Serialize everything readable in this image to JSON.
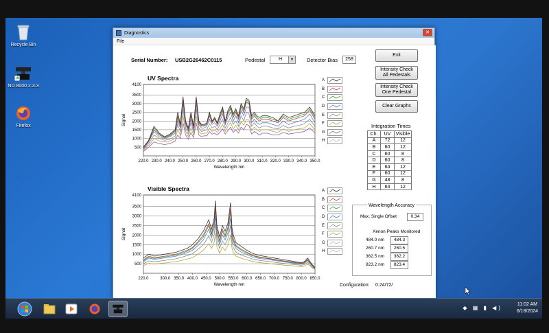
{
  "desktop": {
    "icons": [
      {
        "label": "Recycle Bin"
      },
      {
        "label": "ND 8000 2.3.3"
      },
      {
        "label": "Firefox"
      }
    ]
  },
  "window": {
    "title": "Diagnostics",
    "menu": [
      "File"
    ],
    "serial_label": "Serial Number:",
    "serial_value": "USB2G26462C0115",
    "pedestal_label": "Pedestal",
    "pedestal_value": "H",
    "detector_bias_label": "Detector Bias",
    "detector_bias_value": "258",
    "buttons": {
      "exit": "Exit",
      "intensity_all_1": "Intensity Check",
      "intensity_all_2": "All Pedestals",
      "intensity_one_1": "Intensity Check",
      "intensity_one_2": "One Pedestal",
      "clear": "Clear Graphs"
    },
    "integration": {
      "title": "Integration Times",
      "headers": [
        "Ch.",
        "UV",
        "Visible"
      ],
      "rows": [
        [
          "A",
          "72",
          "12"
        ],
        [
          "B",
          "60",
          "12"
        ],
        [
          "C",
          "60",
          "8"
        ],
        [
          "D",
          "60",
          "8"
        ],
        [
          "E",
          "64",
          "12"
        ],
        [
          "F",
          "60",
          "12"
        ],
        [
          "G",
          "48",
          "8"
        ],
        [
          "H",
          "64",
          "12"
        ]
      ]
    },
    "wavelength_accuracy": {
      "title": "Wavelength Accuracy",
      "max_offset_label": "Max. Single Offset",
      "max_offset_value": "0.34",
      "xenon_title": "Xenon Peaks Monitored",
      "peaks": [
        [
          "484.0 nm",
          "484.3"
        ],
        [
          "260.7 nm",
          "260.5"
        ],
        [
          "362.5 nm",
          "362.2"
        ],
        [
          "823.2 nm",
          "823.4"
        ]
      ]
    },
    "configuration_label": "Configuration:",
    "configuration_value": "0.24/72/"
  },
  "taskbar": {
    "time": "11:02 AM",
    "date": "6/18/2024"
  },
  "colors": {
    "accent": "#2c76cf",
    "series": [
      "#333333",
      "#c04040",
      "#3a9b3a",
      "#4a7ed0",
      "#888888",
      "#b5a640",
      "#9b59b6",
      "#c8c8c8"
    ]
  },
  "chart_data": [
    {
      "type": "line",
      "title": "UV Spectra",
      "xlabel": "Wavelength nm",
      "ylabel": "Signal",
      "xlim": [
        220,
        350
      ],
      "ylim": [
        0,
        4100
      ],
      "xticks": [
        220,
        230,
        240,
        250,
        260,
        270,
        280,
        290,
        300,
        310,
        320,
        330,
        340,
        350
      ],
      "xtick_labels": [
        "220.0",
        "230.0",
        "240.0",
        "250.0",
        "260.0",
        "270.0",
        "280.0",
        "290.0",
        "300.0",
        "310.0",
        "320.0",
        "330.0",
        "340.0",
        "350.0"
      ],
      "yticks": [
        500,
        1000,
        1500,
        2000,
        2500,
        3000,
        3500,
        4100
      ],
      "legend": [
        "A",
        "B",
        "C",
        "D",
        "E",
        "F",
        "G",
        "H"
      ],
      "grid": true,
      "x": [
        220,
        224,
        228,
        232,
        236,
        240,
        244,
        246,
        248,
        250,
        252,
        254,
        256,
        258,
        260,
        262,
        264,
        266,
        268,
        270,
        272,
        274,
        276,
        278,
        280,
        282,
        284,
        286,
        288,
        290,
        292,
        294,
        296,
        298,
        300,
        302,
        304,
        306,
        308,
        310,
        314,
        318,
        322,
        326,
        330,
        334,
        338,
        342,
        346,
        350
      ],
      "series": [
        {
          "values": [
            500,
            900,
            1700,
            1300,
            1100,
            1250,
            1500,
            2500,
            1800,
            3400,
            2000,
            1600,
            2500,
            1700,
            3400,
            2000,
            1800,
            1800,
            1900,
            2500,
            2000,
            2200,
            1900,
            2400,
            2800,
            2000,
            2600,
            2900,
            2400,
            2700,
            2300,
            3000,
            2700,
            3300,
            3200,
            2300,
            2500,
            2300,
            2200,
            2300,
            2300,
            2200,
            2000,
            2400,
            2200,
            2300,
            2400,
            2500,
            2800,
            2300
          ]
        },
        {
          "values": [
            450,
            850,
            1500,
            1200,
            1050,
            1150,
            1400,
            2200,
            1700,
            3200,
            1900,
            1500,
            2300,
            1600,
            3200,
            1900,
            1700,
            1700,
            1800,
            2300,
            1900,
            2100,
            1800,
            2200,
            2600,
            1900,
            2400,
            2700,
            2200,
            2500,
            2100,
            2800,
            2500,
            3100,
            3000,
            2100,
            2300,
            2100,
            2000,
            2100,
            2100,
            2000,
            1900,
            2200,
            2000,
            2100,
            2200,
            2300,
            2600,
            2100
          ]
        },
        {
          "values": [
            480,
            880,
            1600,
            1250,
            1080,
            1200,
            1450,
            2300,
            1750,
            3300,
            1950,
            1550,
            2400,
            1650,
            3300,
            1950,
            1750,
            1750,
            1850,
            2400,
            1950,
            2150,
            1850,
            2300,
            2700,
            1950,
            2500,
            2800,
            2300,
            2600,
            2200,
            2900,
            2600,
            3200,
            3100,
            2200,
            2400,
            2200,
            2100,
            2200,
            2200,
            2100,
            2000,
            2300,
            2100,
            2200,
            2300,
            2400,
            2700,
            2200
          ]
        },
        {
          "values": [
            400,
            800,
            1400,
            1100,
            1000,
            1100,
            1300,
            2000,
            1600,
            3000,
            1800,
            1400,
            2100,
            1500,
            3000,
            1800,
            1600,
            1600,
            1700,
            2100,
            1800,
            1900,
            1700,
            2000,
            2400,
            1800,
            2200,
            2500,
            2000,
            2300,
            1900,
            2600,
            2300,
            2800,
            2800,
            1900,
            2100,
            1900,
            1800,
            1900,
            1900,
            1800,
            1700,
            2000,
            1800,
            1900,
            2000,
            2100,
            2400,
            1900
          ]
        },
        {
          "values": [
            350,
            700,
            1200,
            1000,
            900,
            950,
            1150,
            1800,
            1400,
            2700,
            1600,
            1250,
            1900,
            1350,
            2700,
            1600,
            1400,
            1450,
            1500,
            1850,
            1600,
            1700,
            1500,
            1800,
            2100,
            1600,
            1900,
            2200,
            1800,
            2000,
            1700,
            2300,
            2000,
            2500,
            2400,
            1700,
            1900,
            1700,
            1600,
            1700,
            1700,
            1600,
            1550,
            1750,
            1600,
            1700,
            1750,
            1850,
            2100,
            1700
          ]
        },
        {
          "values": [
            300,
            600,
            1000,
            850,
            800,
            850,
            1000,
            1500,
            1200,
            2300,
            1400,
            1100,
            1600,
            1200,
            2300,
            1400,
            1250,
            1300,
            1300,
            1600,
            1400,
            1500,
            1350,
            1550,
            1800,
            1400,
            1700,
            1900,
            1550,
            1750,
            1500,
            1950,
            1750,
            2100,
            2050,
            1450,
            1650,
            1500,
            1400,
            1500,
            1500,
            1400,
            1350,
            1550,
            1400,
            1500,
            1550,
            1600,
            1850,
            1500
          ]
        },
        {
          "values": [
            250,
            500,
            800,
            700,
            650,
            700,
            850,
            1200,
            1000,
            1900,
            1200,
            950,
            1350,
            1050,
            1900,
            1200,
            1100,
            1150,
            1150,
            1400,
            1250,
            1300,
            1200,
            1350,
            1550,
            1250,
            1450,
            1650,
            1350,
            1500,
            1300,
            1650,
            1500,
            1800,
            1750,
            1250,
            1400,
            1300,
            1200,
            1300,
            1300,
            1200,
            1200,
            1350,
            1250,
            1300,
            1350,
            1400,
            1600,
            1300
          ]
        }
      ]
    },
    {
      "type": "line",
      "title": "Visible Spectra",
      "xlabel": "Wavelength nm",
      "ylabel": "Signal",
      "xlim": [
        220,
        850
      ],
      "ylim": [
        0,
        4100
      ],
      "xticks": [
        220,
        300,
        350,
        400,
        450,
        500,
        550,
        600,
        650,
        700,
        750,
        800,
        850
      ],
      "xtick_labels": [
        "220.0",
        "300.0",
        "350.0",
        "400.0",
        "450.0",
        "500.0",
        "550.0",
        "600.0",
        "650.0",
        "700.0",
        "750.0",
        "800.0",
        "850.0"
      ],
      "yticks": [
        500,
        1000,
        1500,
        2000,
        2500,
        3000,
        3500,
        4100
      ],
      "legend": [
        "A",
        "B",
        "C",
        "D",
        "E",
        "F",
        "G",
        "H"
      ],
      "grid": true,
      "x": [
        220,
        240,
        260,
        280,
        300,
        320,
        340,
        360,
        380,
        400,
        420,
        440,
        460,
        470,
        480,
        484,
        490,
        500,
        510,
        520,
        530,
        540,
        545,
        550,
        560,
        580,
        600,
        620,
        640,
        660,
        680,
        700,
        720,
        740,
        760,
        780,
        800,
        810,
        823,
        840,
        850
      ],
      "series": [
        {
          "values": [
            800,
            1000,
            900,
            950,
            1000,
            1050,
            1100,
            1200,
            1300,
            1500,
            1800,
            2200,
            2800,
            2300,
            2900,
            3800,
            2500,
            1900,
            2500,
            2200,
            2600,
            3700,
            2400,
            2000,
            1600,
            1400,
            1200,
            1050,
            950,
            900,
            850,
            800,
            750,
            700,
            650,
            600,
            550,
            600,
            800,
            450,
            300
          ]
        },
        {
          "values": [
            700,
            900,
            820,
            860,
            900,
            950,
            1000,
            1100,
            1200,
            1350,
            1650,
            2000,
            2600,
            2100,
            2700,
            3500,
            2300,
            1700,
            2300,
            2000,
            2400,
            3400,
            2200,
            1800,
            1450,
            1250,
            1100,
            950,
            870,
            820,
            780,
            730,
            680,
            640,
            600,
            560,
            520,
            560,
            720,
            420,
            280
          ]
        },
        {
          "values": [
            650,
            850,
            780,
            820,
            860,
            900,
            950,
            1050,
            1150,
            1300,
            1600,
            1900,
            2500,
            2000,
            2600,
            3300,
            2200,
            1650,
            2200,
            1900,
            2300,
            3200,
            2100,
            1700,
            1400,
            1200,
            1050,
            920,
            840,
            800,
            760,
            710,
            660,
            620,
            580,
            540,
            500,
            540,
            700,
            400,
            270
          ]
        },
        {
          "values": [
            600,
            800,
            730,
            770,
            810,
            850,
            900,
            980,
            1080,
            1200,
            1450,
            1750,
            2300,
            1850,
            2400,
            3000,
            2000,
            1500,
            2000,
            1750,
            2100,
            2900,
            1900,
            1550,
            1300,
            1100,
            980,
            860,
            790,
            750,
            720,
            670,
            630,
            590,
            550,
            510,
            480,
            520,
            660,
            380,
            250
          ]
        },
        {
          "values": [
            500,
            650,
            600,
            640,
            680,
            720,
            760,
            840,
            920,
            1020,
            1250,
            1500,
            1950,
            1600,
            2050,
            2600,
            1750,
            1300,
            1700,
            1500,
            1800,
            2500,
            1650,
            1350,
            1100,
            950,
            850,
            750,
            690,
            650,
            620,
            580,
            540,
            510,
            480,
            450,
            420,
            450,
            580,
            330,
            220
          ]
        },
        {
          "values": [
            400,
            520,
            480,
            510,
            540,
            580,
            610,
            670,
            740,
            820,
            1000,
            1200,
            1550,
            1300,
            1650,
            2100,
            1400,
            1050,
            1380,
            1200,
            1450,
            2000,
            1320,
            1080,
            900,
            780,
            700,
            620,
            570,
            540,
            510,
            480,
            450,
            420,
            400,
            370,
            350,
            370,
            480,
            280,
            190
          ]
        }
      ]
    }
  ]
}
